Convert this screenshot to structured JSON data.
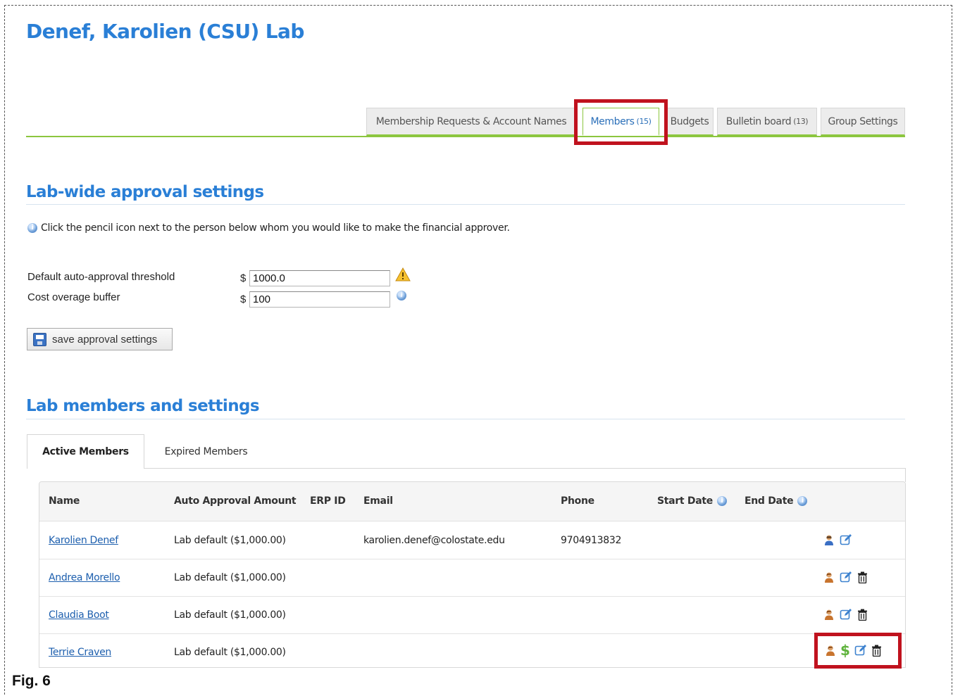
{
  "page_title": "Denef, Karolien (CSU) Lab",
  "tabs": [
    {
      "label": "Membership Requests & Account Names",
      "count": ""
    },
    {
      "label": "Members",
      "count": "(15)"
    },
    {
      "label": "Budgets",
      "count": ""
    },
    {
      "label": "Bulletin board",
      "count": "(13)"
    },
    {
      "label": "Group Settings",
      "count": ""
    }
  ],
  "active_tab": "Members",
  "approval": {
    "title": "Lab-wide approval settings",
    "hint": "Click the pencil icon next to the person below whom you would like to make the financial approver.",
    "threshold_label": "Default auto-approval threshold",
    "threshold_currency": "$",
    "threshold_value": "1000.0",
    "buffer_label": "Cost overage buffer",
    "buffer_currency": "$",
    "buffer_value": "100",
    "save_label": "save approval settings"
  },
  "members": {
    "title": "Lab members and settings",
    "subtabs": [
      "Active Members",
      "Expired Members"
    ],
    "columns": [
      "Name",
      "Auto Approval Amount",
      "ERP ID",
      "Email",
      "Phone",
      "Start Date",
      "End Date"
    ],
    "rows": [
      {
        "name": "Karolien Denef",
        "approval": "Lab default ($1,000.00)",
        "erp": "",
        "email": "karolien.denef@colostate.edu",
        "phone": "9704913832",
        "start": "",
        "end": ""
      },
      {
        "name": "Andrea Morello",
        "approval": "Lab default ($1,000.00)",
        "erp": "",
        "email": "",
        "phone": "",
        "start": "",
        "end": ""
      },
      {
        "name": "Claudia Boot",
        "approval": "Lab default ($1,000.00)",
        "erp": "",
        "email": "",
        "phone": "",
        "start": "",
        "end": ""
      },
      {
        "name": "Terrie Craven",
        "approval": "Lab default ($1,000.00)",
        "erp": "",
        "email": "",
        "phone": "",
        "start": "",
        "end": ""
      }
    ]
  },
  "figure_caption": "Fig. 6",
  "colors": {
    "title_blue": "#2a7fd6",
    "tab_accent": "#8cc63f",
    "highlight": "#c0121e",
    "link": "#1d5fae",
    "dollar_green": "#5fb33c"
  }
}
